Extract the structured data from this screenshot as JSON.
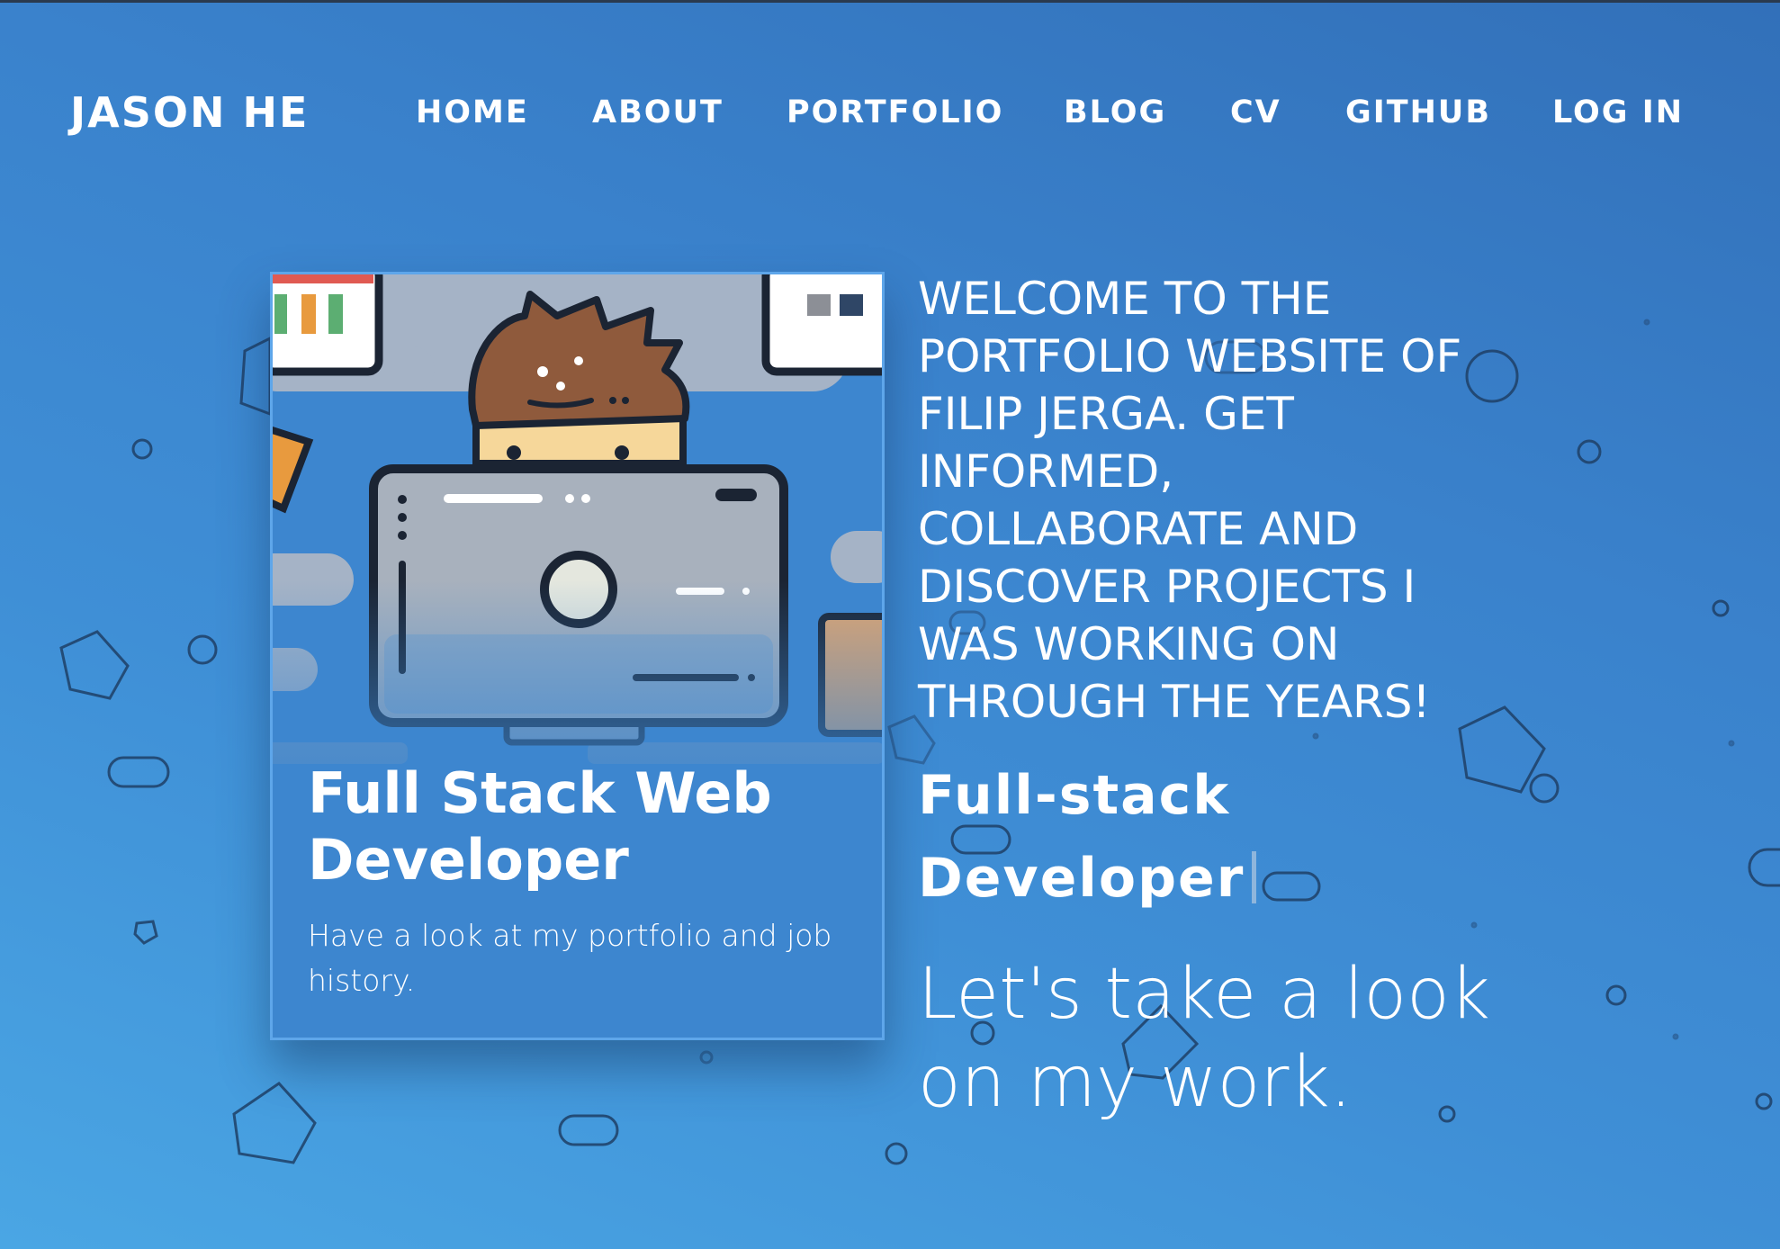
{
  "header": {
    "brand": "JASON HE",
    "nav": [
      {
        "label": "HOME"
      },
      {
        "label": "ABOUT"
      },
      {
        "label": "PORTFOLIO"
      },
      {
        "label": "BLOG"
      },
      {
        "label": "CV"
      },
      {
        "label": "GITHUB"
      },
      {
        "label": "LOG IN"
      }
    ]
  },
  "card": {
    "illustration": "developer-at-computer-illustration",
    "title": "Full Stack Web Developer",
    "text": "Have a look at my portfolio and job history."
  },
  "hero": {
    "welcome": "WELCOME TO THE PORTFOLIO WEBSITE OF FILIP JERGA. GET INFORMED, COLLABORATE AND DISCOVER PROJECTS I WAS WORKING ON THROUGH THE YEARS!",
    "role": "Full-stack Developer",
    "tagline": "Let's take a look on my work."
  },
  "colors": {
    "background_light": "#4aa6e4",
    "background_dark": "#3270b9",
    "text": "#ffffff",
    "shape_outline": "#1f3f66"
  }
}
